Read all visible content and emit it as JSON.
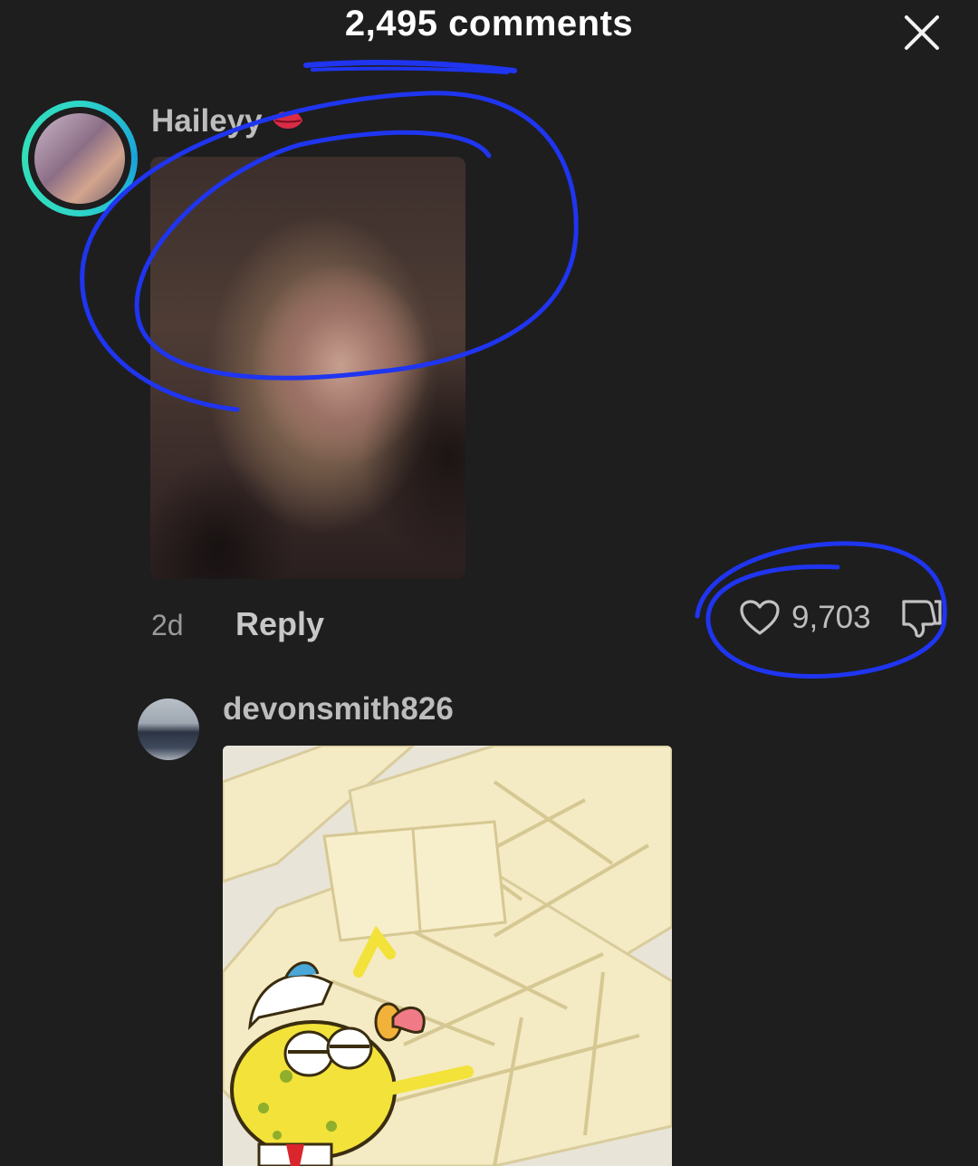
{
  "header": {
    "title": "2,495 comments",
    "close_icon": "close-icon"
  },
  "comments": [
    {
      "username": "Haileyy",
      "emoji_icon": "lips-icon",
      "attachment": "photo",
      "time": "2d",
      "reply_label": "Reply",
      "likes": "9,703"
    },
    {
      "username": "devonsmith826",
      "attachment": "image"
    }
  ],
  "colors": {
    "background": "#1e1e1f",
    "annotation": "#1f35f0",
    "avatar_ring": "#2fd6c8"
  }
}
